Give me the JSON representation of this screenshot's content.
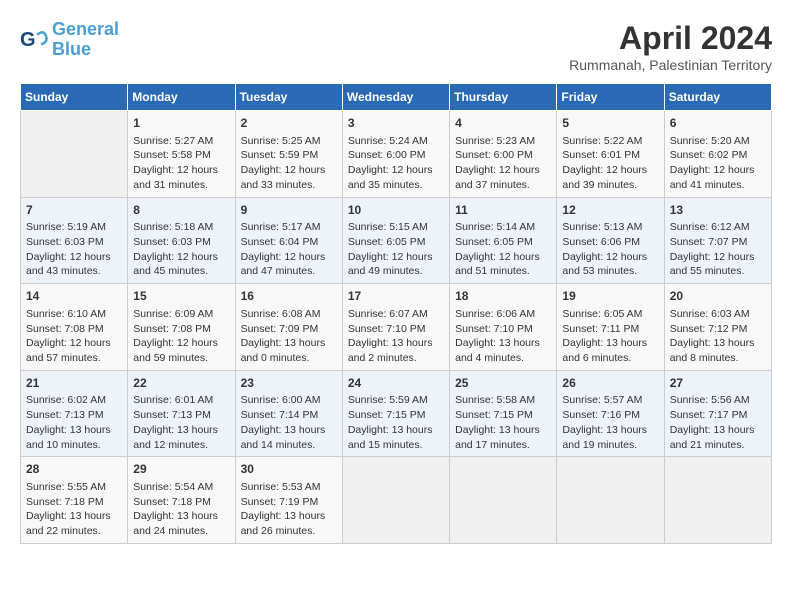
{
  "header": {
    "logo_line1": "General",
    "logo_line2": "Blue",
    "month_title": "April 2024",
    "location": "Rummanah, Palestinian Territory"
  },
  "days_of_week": [
    "Sunday",
    "Monday",
    "Tuesday",
    "Wednesday",
    "Thursday",
    "Friday",
    "Saturday"
  ],
  "weeks": [
    [
      {
        "day": "",
        "content": ""
      },
      {
        "day": "1",
        "content": "Sunrise: 5:27 AM\nSunset: 5:58 PM\nDaylight: 12 hours\nand 31 minutes."
      },
      {
        "day": "2",
        "content": "Sunrise: 5:25 AM\nSunset: 5:59 PM\nDaylight: 12 hours\nand 33 minutes."
      },
      {
        "day": "3",
        "content": "Sunrise: 5:24 AM\nSunset: 6:00 PM\nDaylight: 12 hours\nand 35 minutes."
      },
      {
        "day": "4",
        "content": "Sunrise: 5:23 AM\nSunset: 6:00 PM\nDaylight: 12 hours\nand 37 minutes."
      },
      {
        "day": "5",
        "content": "Sunrise: 5:22 AM\nSunset: 6:01 PM\nDaylight: 12 hours\nand 39 minutes."
      },
      {
        "day": "6",
        "content": "Sunrise: 5:20 AM\nSunset: 6:02 PM\nDaylight: 12 hours\nand 41 minutes."
      }
    ],
    [
      {
        "day": "7",
        "content": "Sunrise: 5:19 AM\nSunset: 6:03 PM\nDaylight: 12 hours\nand 43 minutes."
      },
      {
        "day": "8",
        "content": "Sunrise: 5:18 AM\nSunset: 6:03 PM\nDaylight: 12 hours\nand 45 minutes."
      },
      {
        "day": "9",
        "content": "Sunrise: 5:17 AM\nSunset: 6:04 PM\nDaylight: 12 hours\nand 47 minutes."
      },
      {
        "day": "10",
        "content": "Sunrise: 5:15 AM\nSunset: 6:05 PM\nDaylight: 12 hours\nand 49 minutes."
      },
      {
        "day": "11",
        "content": "Sunrise: 5:14 AM\nSunset: 6:05 PM\nDaylight: 12 hours\nand 51 minutes."
      },
      {
        "day": "12",
        "content": "Sunrise: 5:13 AM\nSunset: 6:06 PM\nDaylight: 12 hours\nand 53 minutes."
      },
      {
        "day": "13",
        "content": "Sunrise: 6:12 AM\nSunset: 7:07 PM\nDaylight: 12 hours\nand 55 minutes."
      }
    ],
    [
      {
        "day": "14",
        "content": "Sunrise: 6:10 AM\nSunset: 7:08 PM\nDaylight: 12 hours\nand 57 minutes."
      },
      {
        "day": "15",
        "content": "Sunrise: 6:09 AM\nSunset: 7:08 PM\nDaylight: 12 hours\nand 59 minutes."
      },
      {
        "day": "16",
        "content": "Sunrise: 6:08 AM\nSunset: 7:09 PM\nDaylight: 13 hours\nand 0 minutes."
      },
      {
        "day": "17",
        "content": "Sunrise: 6:07 AM\nSunset: 7:10 PM\nDaylight: 13 hours\nand 2 minutes."
      },
      {
        "day": "18",
        "content": "Sunrise: 6:06 AM\nSunset: 7:10 PM\nDaylight: 13 hours\nand 4 minutes."
      },
      {
        "day": "19",
        "content": "Sunrise: 6:05 AM\nSunset: 7:11 PM\nDaylight: 13 hours\nand 6 minutes."
      },
      {
        "day": "20",
        "content": "Sunrise: 6:03 AM\nSunset: 7:12 PM\nDaylight: 13 hours\nand 8 minutes."
      }
    ],
    [
      {
        "day": "21",
        "content": "Sunrise: 6:02 AM\nSunset: 7:13 PM\nDaylight: 13 hours\nand 10 minutes."
      },
      {
        "day": "22",
        "content": "Sunrise: 6:01 AM\nSunset: 7:13 PM\nDaylight: 13 hours\nand 12 minutes."
      },
      {
        "day": "23",
        "content": "Sunrise: 6:00 AM\nSunset: 7:14 PM\nDaylight: 13 hours\nand 14 minutes."
      },
      {
        "day": "24",
        "content": "Sunrise: 5:59 AM\nSunset: 7:15 PM\nDaylight: 13 hours\nand 15 minutes."
      },
      {
        "day": "25",
        "content": "Sunrise: 5:58 AM\nSunset: 7:15 PM\nDaylight: 13 hours\nand 17 minutes."
      },
      {
        "day": "26",
        "content": "Sunrise: 5:57 AM\nSunset: 7:16 PM\nDaylight: 13 hours\nand 19 minutes."
      },
      {
        "day": "27",
        "content": "Sunrise: 5:56 AM\nSunset: 7:17 PM\nDaylight: 13 hours\nand 21 minutes."
      }
    ],
    [
      {
        "day": "28",
        "content": "Sunrise: 5:55 AM\nSunset: 7:18 PM\nDaylight: 13 hours\nand 22 minutes."
      },
      {
        "day": "29",
        "content": "Sunrise: 5:54 AM\nSunset: 7:18 PM\nDaylight: 13 hours\nand 24 minutes."
      },
      {
        "day": "30",
        "content": "Sunrise: 5:53 AM\nSunset: 7:19 PM\nDaylight: 13 hours\nand 26 minutes."
      },
      {
        "day": "",
        "content": ""
      },
      {
        "day": "",
        "content": ""
      },
      {
        "day": "",
        "content": ""
      },
      {
        "day": "",
        "content": ""
      }
    ]
  ]
}
